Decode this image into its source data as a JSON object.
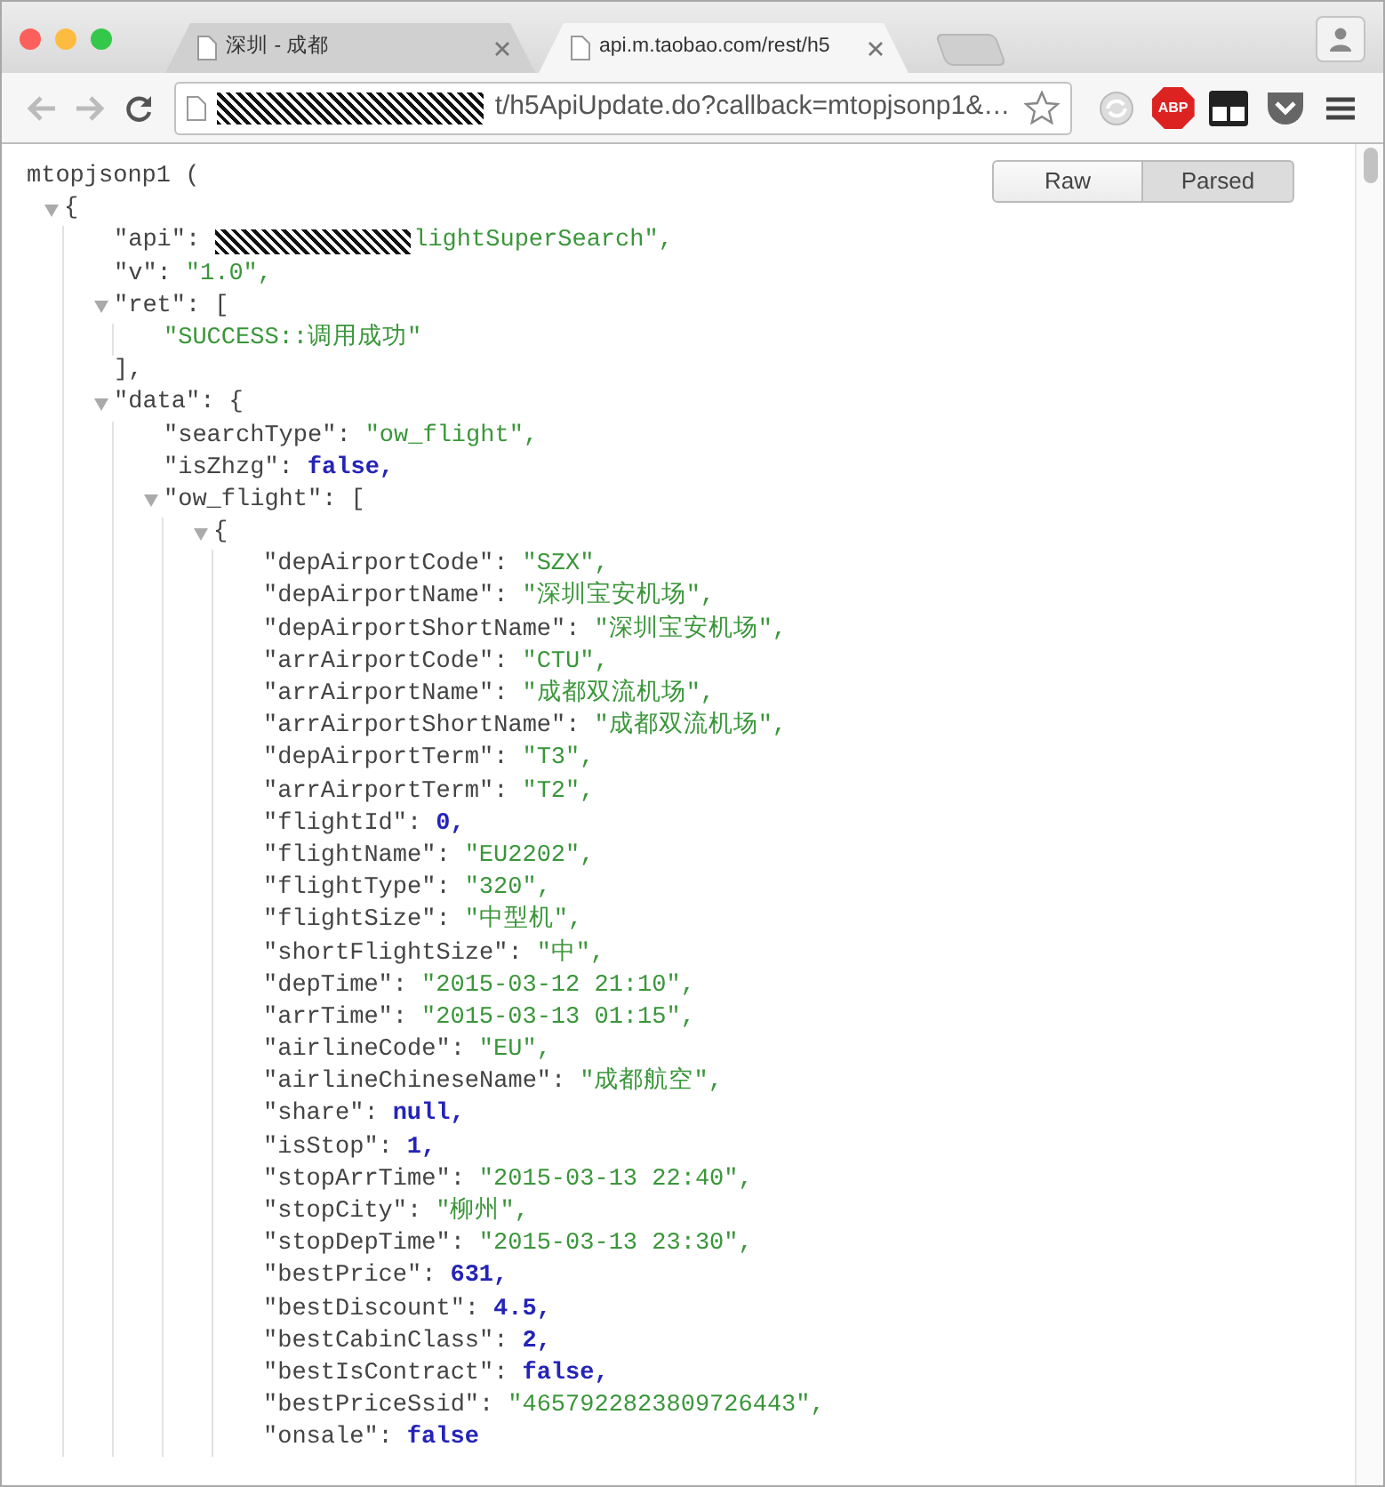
{
  "browser": {
    "tabs": [
      {
        "title": "深圳 - 成都",
        "selected": false
      },
      {
        "title": "api.m.taobao.com/rest/h5",
        "selected": true
      }
    ],
    "address_bar": {
      "url": "t/h5ApiUpdate.do?callback=mtopjsonp1&…",
      "redacted": true
    },
    "abp_label": "ABP"
  },
  "viewer": {
    "view_toggle": [
      {
        "label": "Raw",
        "selected": false
      },
      {
        "label": "Parsed",
        "selected": true
      }
    ],
    "callback": "mtopjsonp1 (",
    "root": {
      "open": "{",
      "expanded": true,
      "children": [
        {
          "key": "\"api\":",
          "value": "lightSuperSearch\",",
          "kind": "string",
          "redacted": true
        },
        {
          "key": "\"v\":",
          "value": "\"1.0\",",
          "kind": "string"
        },
        {
          "key": "\"ret\":",
          "open": "[",
          "expanded": true,
          "close": "],",
          "children": [
            {
              "value": "\"SUCCESS::调用成功\"",
              "kind": "string"
            }
          ]
        },
        {
          "key": "\"data\":",
          "open": "{",
          "expanded": true,
          "children": [
            {
              "key": "\"searchType\":",
              "value": "\"ow_flight\",",
              "kind": "string"
            },
            {
              "key": "\"isZhzg\":",
              "value": "false,",
              "kind": "literal"
            },
            {
              "key": "\"ow_flight\":",
              "open": "[",
              "expanded": true,
              "children": [
                {
                  "open": "{",
                  "expanded": true,
                  "children": [
                    {
                      "key": "\"depAirportCode\":",
                      "value": "\"SZX\",",
                      "kind": "string"
                    },
                    {
                      "key": "\"depAirportName\":",
                      "value": "\"深圳宝安机场\",",
                      "kind": "string"
                    },
                    {
                      "key": "\"depAirportShortName\":",
                      "value": "\"深圳宝安机场\",",
                      "kind": "string"
                    },
                    {
                      "key": "\"arrAirportCode\":",
                      "value": "\"CTU\",",
                      "kind": "string"
                    },
                    {
                      "key": "\"arrAirportName\":",
                      "value": "\"成都双流机场\",",
                      "kind": "string"
                    },
                    {
                      "key": "\"arrAirportShortName\":",
                      "value": "\"成都双流机场\",",
                      "kind": "string"
                    },
                    {
                      "key": "\"depAirportTerm\":",
                      "value": "\"T3\",",
                      "kind": "string"
                    },
                    {
                      "key": "\"arrAirportTerm\":",
                      "value": "\"T2\",",
                      "kind": "string"
                    },
                    {
                      "key": "\"flightId\":",
                      "value": "0,",
                      "kind": "literal"
                    },
                    {
                      "key": "\"flightName\":",
                      "value": "\"EU2202\",",
                      "kind": "string"
                    },
                    {
                      "key": "\"flightType\":",
                      "value": "\"320\",",
                      "kind": "string"
                    },
                    {
                      "key": "\"flightSize\":",
                      "value": "\"中型机\",",
                      "kind": "string"
                    },
                    {
                      "key": "\"shortFlightSize\":",
                      "value": "\"中\",",
                      "kind": "string"
                    },
                    {
                      "key": "\"depTime\":",
                      "value": "\"2015-03-12 21:10\",",
                      "kind": "string"
                    },
                    {
                      "key": "\"arrTime\":",
                      "value": "\"2015-03-13 01:15\",",
                      "kind": "string"
                    },
                    {
                      "key": "\"airlineCode\":",
                      "value": "\"EU\",",
                      "kind": "string"
                    },
                    {
                      "key": "\"airlineChineseName\":",
                      "value": "\"成都航空\",",
                      "kind": "string"
                    },
                    {
                      "key": "\"share\":",
                      "value": "null,",
                      "kind": "literal"
                    },
                    {
                      "key": "\"isStop\":",
                      "value": "1,",
                      "kind": "literal"
                    },
                    {
                      "key": "\"stopArrTime\":",
                      "value": "\"2015-03-13 22:40\",",
                      "kind": "string"
                    },
                    {
                      "key": "\"stopCity\":",
                      "value": "\"柳州\",",
                      "kind": "string"
                    },
                    {
                      "key": "\"stopDepTime\":",
                      "value": "\"2015-03-13 23:30\",",
                      "kind": "string"
                    },
                    {
                      "key": "\"bestPrice\":",
                      "value": "631,",
                      "kind": "literal"
                    },
                    {
                      "key": "\"bestDiscount\":",
                      "value": "4.5,",
                      "kind": "literal"
                    },
                    {
                      "key": "\"bestCabinClass\":",
                      "value": "2,",
                      "kind": "literal"
                    },
                    {
                      "key": "\"bestIsContract\":",
                      "value": "false,",
                      "kind": "literal"
                    },
                    {
                      "key": "\"bestPriceSsid\":",
                      "value": "\"4657922823809726443\",",
                      "kind": "string"
                    },
                    {
                      "key": "\"onsale\":",
                      "value": "false",
                      "kind": "literal"
                    }
                  ]
                }
              ]
            }
          ]
        }
      ]
    }
  }
}
